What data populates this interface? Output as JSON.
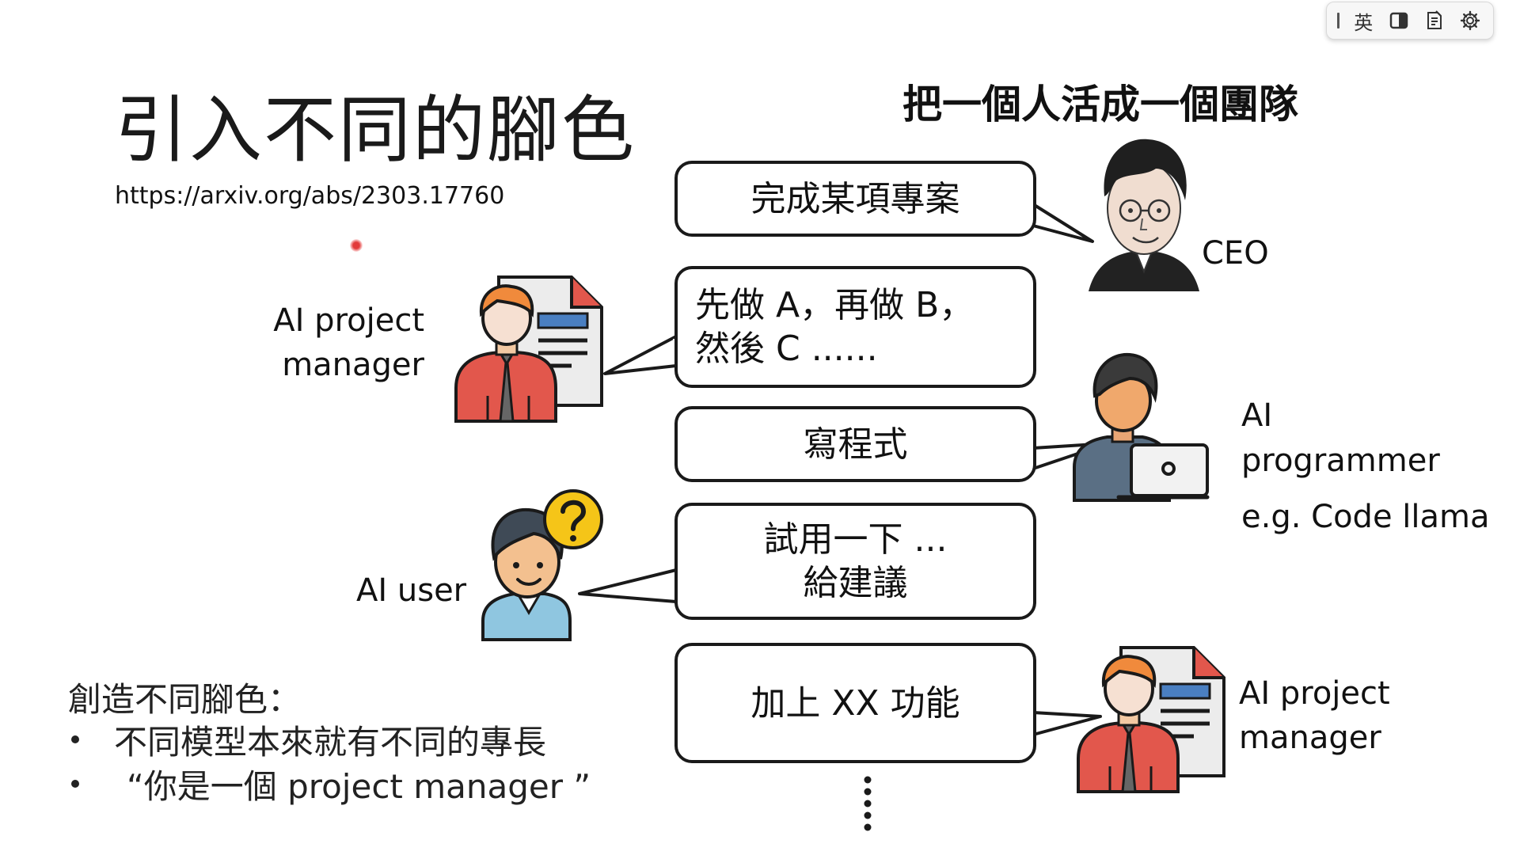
{
  "ime_toolbar": {
    "language_label": "英",
    "icons": [
      "toolbar-grip-icon",
      "half-square-icon",
      "dictionary-icon",
      "gear-icon"
    ]
  },
  "slide": {
    "title": "引入不同的腳色",
    "url": "https://arxiv.org/abs/2303.17760",
    "headline": "把一個人活成一個團隊",
    "bubbles": [
      {
        "lines": [
          "完成某項專案"
        ]
      },
      {
        "lines": [
          "先做 A，再做 B，",
          "然後 C ......"
        ]
      },
      {
        "lines": [
          "寫程式"
        ]
      },
      {
        "lines": [
          "試用一下 ...",
          "給建議"
        ]
      },
      {
        "lines": [
          "加上 XX 功能"
        ]
      }
    ],
    "roles": {
      "ceo": {
        "label": "CEO"
      },
      "pm_top": {
        "line1": "AI project",
        "line2": "manager"
      },
      "programmer": {
        "line1": "AI",
        "line2": "programmer",
        "line3": "e.g. Code llama"
      },
      "user": {
        "label": "AI user"
      },
      "pm_bottom": {
        "line1": "AI project",
        "line2": "manager"
      }
    },
    "bottom_heading": "創造不同腳色：",
    "bullets": [
      "不同模型本來就有不同的專長",
      "“你是一個 project manager ”"
    ]
  },
  "colors": {
    "bubble_border": "#1a1a1a",
    "laser": "#e23a3a",
    "shirt_red": "#e2574c",
    "skin": "#f3c9a3",
    "hair_orange": "#f08a3c",
    "doc_blue": "#4a7fc1",
    "question_yellow": "#f5c518"
  }
}
